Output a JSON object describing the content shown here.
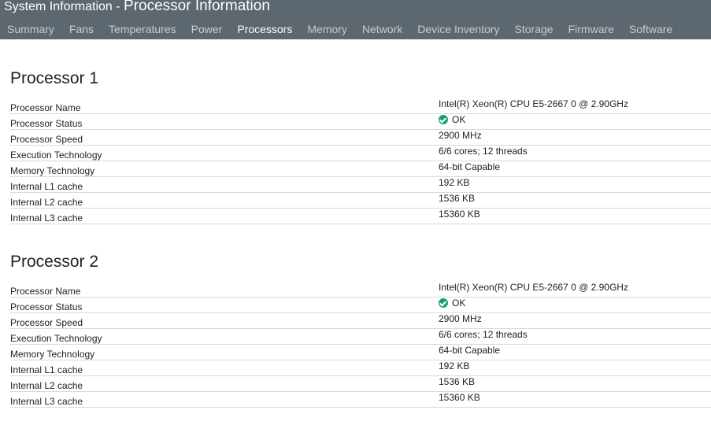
{
  "header": {
    "app_title": "System Information",
    "separator": " - ",
    "page_title": "Processor Information",
    "tabs": [
      {
        "label": "Summary"
      },
      {
        "label": "Fans"
      },
      {
        "label": "Temperatures"
      },
      {
        "label": "Power"
      },
      {
        "label": "Processors"
      },
      {
        "label": "Memory"
      },
      {
        "label": "Network"
      },
      {
        "label": "Device Inventory"
      },
      {
        "label": "Storage"
      },
      {
        "label": "Firmware"
      },
      {
        "label": "Software"
      }
    ],
    "active_tab": "Processors"
  },
  "processors": [
    {
      "title": "Processor 1",
      "rows": [
        {
          "label": "Processor Name",
          "value": "Intel(R) Xeon(R) CPU E5-2667 0 @ 2.90GHz"
        },
        {
          "label": "Processor Status",
          "value": "OK"
        },
        {
          "label": "Processor Speed",
          "value": "2900 MHz"
        },
        {
          "label": "Execution Technology",
          "value": "6/6 cores; 12 threads"
        },
        {
          "label": "Memory Technology",
          "value": "64-bit Capable"
        },
        {
          "label": "Internal L1 cache",
          "value": "192 KB"
        },
        {
          "label": "Internal L2 cache",
          "value": "1536 KB"
        },
        {
          "label": "Internal L3 cache",
          "value": "15360 KB"
        }
      ]
    },
    {
      "title": "Processor 2",
      "rows": [
        {
          "label": "Processor Name",
          "value": "Intel(R) Xeon(R) CPU E5-2667 0 @ 2.90GHz"
        },
        {
          "label": "Processor Status",
          "value": "OK"
        },
        {
          "label": "Processor Speed",
          "value": "2900 MHz"
        },
        {
          "label": "Execution Technology",
          "value": "6/6 cores; 12 threads"
        },
        {
          "label": "Memory Technology",
          "value": "64-bit Capable"
        },
        {
          "label": "Internal L1 cache",
          "value": "192 KB"
        },
        {
          "label": "Internal L2 cache",
          "value": "1536 KB"
        },
        {
          "label": "Internal L3 cache",
          "value": "15360 KB"
        }
      ]
    }
  ],
  "colors": {
    "header_bg": "#5c6770",
    "tab_inactive": "#c6ccd1",
    "tab_active": "#ffffff",
    "status_ok": "#1aa16e"
  }
}
